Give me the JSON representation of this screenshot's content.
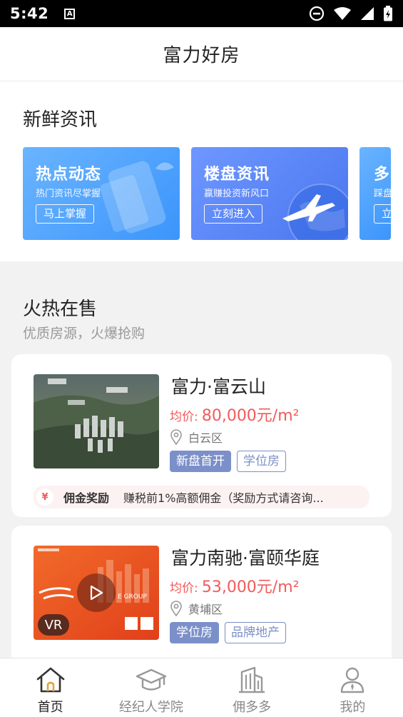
{
  "status_bar": {
    "time": "5:42",
    "a_icon": "A"
  },
  "header": {
    "title": "富力好房"
  },
  "news": {
    "title": "新鲜资讯",
    "cards": [
      {
        "title": "热点动态",
        "subtitle": "热门资讯尽掌握",
        "button": "马上掌握",
        "icon": "phone-illustration",
        "color": "#4a9dfc"
      },
      {
        "title": "楼盘资讯",
        "subtitle": "赢赚投资新风口",
        "button": "立刻进入",
        "icon": "globe-airplane-illustration",
        "color": "#5a84f2"
      },
      {
        "title": "多",
        "subtitle": "踩盘",
        "button": "立",
        "color": "#4a9dfc"
      }
    ]
  },
  "hot_sale": {
    "title": "火热在售",
    "subtitle": "优质房源，火爆抢购",
    "properties": [
      {
        "name": "富力·富云山",
        "price_label": "均价:",
        "price": "80,000元/m²",
        "location": "白云区",
        "tags": [
          "新盘首开",
          "学位房"
        ],
        "commission_label": "佣金奖励",
        "commission_text": "赚税前1%高额佣金（奖励方式请咨询..."
      },
      {
        "name": "富力南驰·富颐华庭",
        "price_label": "均价:",
        "price": "53,000元/m²",
        "location": "黄埔区",
        "tags": [
          "学位房",
          "品牌地产"
        ],
        "vr_badge": "VR",
        "thumb_caption": "E GROUP"
      }
    ]
  },
  "bottom_nav": [
    {
      "label": "首页",
      "icon": "home-icon",
      "active": true
    },
    {
      "label": "经纪人学院",
      "icon": "graduation-cap-icon",
      "active": false
    },
    {
      "label": "佣多多",
      "icon": "building-icon",
      "active": false
    },
    {
      "label": "我的",
      "icon": "user-icon",
      "active": false
    }
  ],
  "colors": {
    "price": "#f25a5a",
    "tag": "#7b8fc9",
    "card_blue": "#4a9dfc"
  }
}
